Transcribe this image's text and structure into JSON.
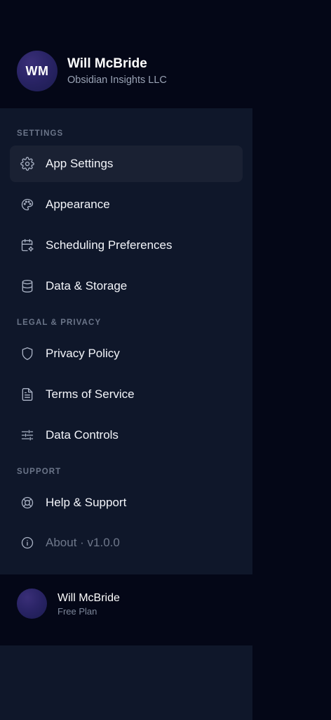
{
  "profile": {
    "initials": "WM",
    "name": "Will McBride",
    "organization": "Obsidian Insights LLC"
  },
  "sections": {
    "settings": {
      "label": "SETTINGS",
      "items": [
        {
          "label": "App Settings",
          "icon": "gear-icon",
          "active": true
        },
        {
          "label": "Appearance",
          "icon": "palette-icon"
        },
        {
          "label": "Scheduling Preferences",
          "icon": "calendar-settings-icon"
        },
        {
          "label": "Data & Storage",
          "icon": "database-icon"
        }
      ]
    },
    "legal": {
      "label": "LEGAL & PRIVACY",
      "items": [
        {
          "label": "Privacy Policy",
          "icon": "shield-icon"
        },
        {
          "label": "Terms of Service",
          "icon": "document-icon"
        },
        {
          "label": "Data Controls",
          "icon": "sliders-icon"
        }
      ]
    },
    "support": {
      "label": "SUPPORT",
      "items": [
        {
          "label": "Help & Support",
          "icon": "lifebuoy-icon"
        },
        {
          "label": "About · v1.0.0",
          "icon": "info-icon",
          "muted": true
        }
      ]
    }
  },
  "footer": {
    "name": "Will McBride",
    "plan": "Free Plan"
  },
  "colors": {
    "background": "#040717",
    "panel": "#0f172a",
    "active_item": "#1a2133",
    "icon": "#a9b2c4",
    "muted_text": "#6f788b"
  }
}
